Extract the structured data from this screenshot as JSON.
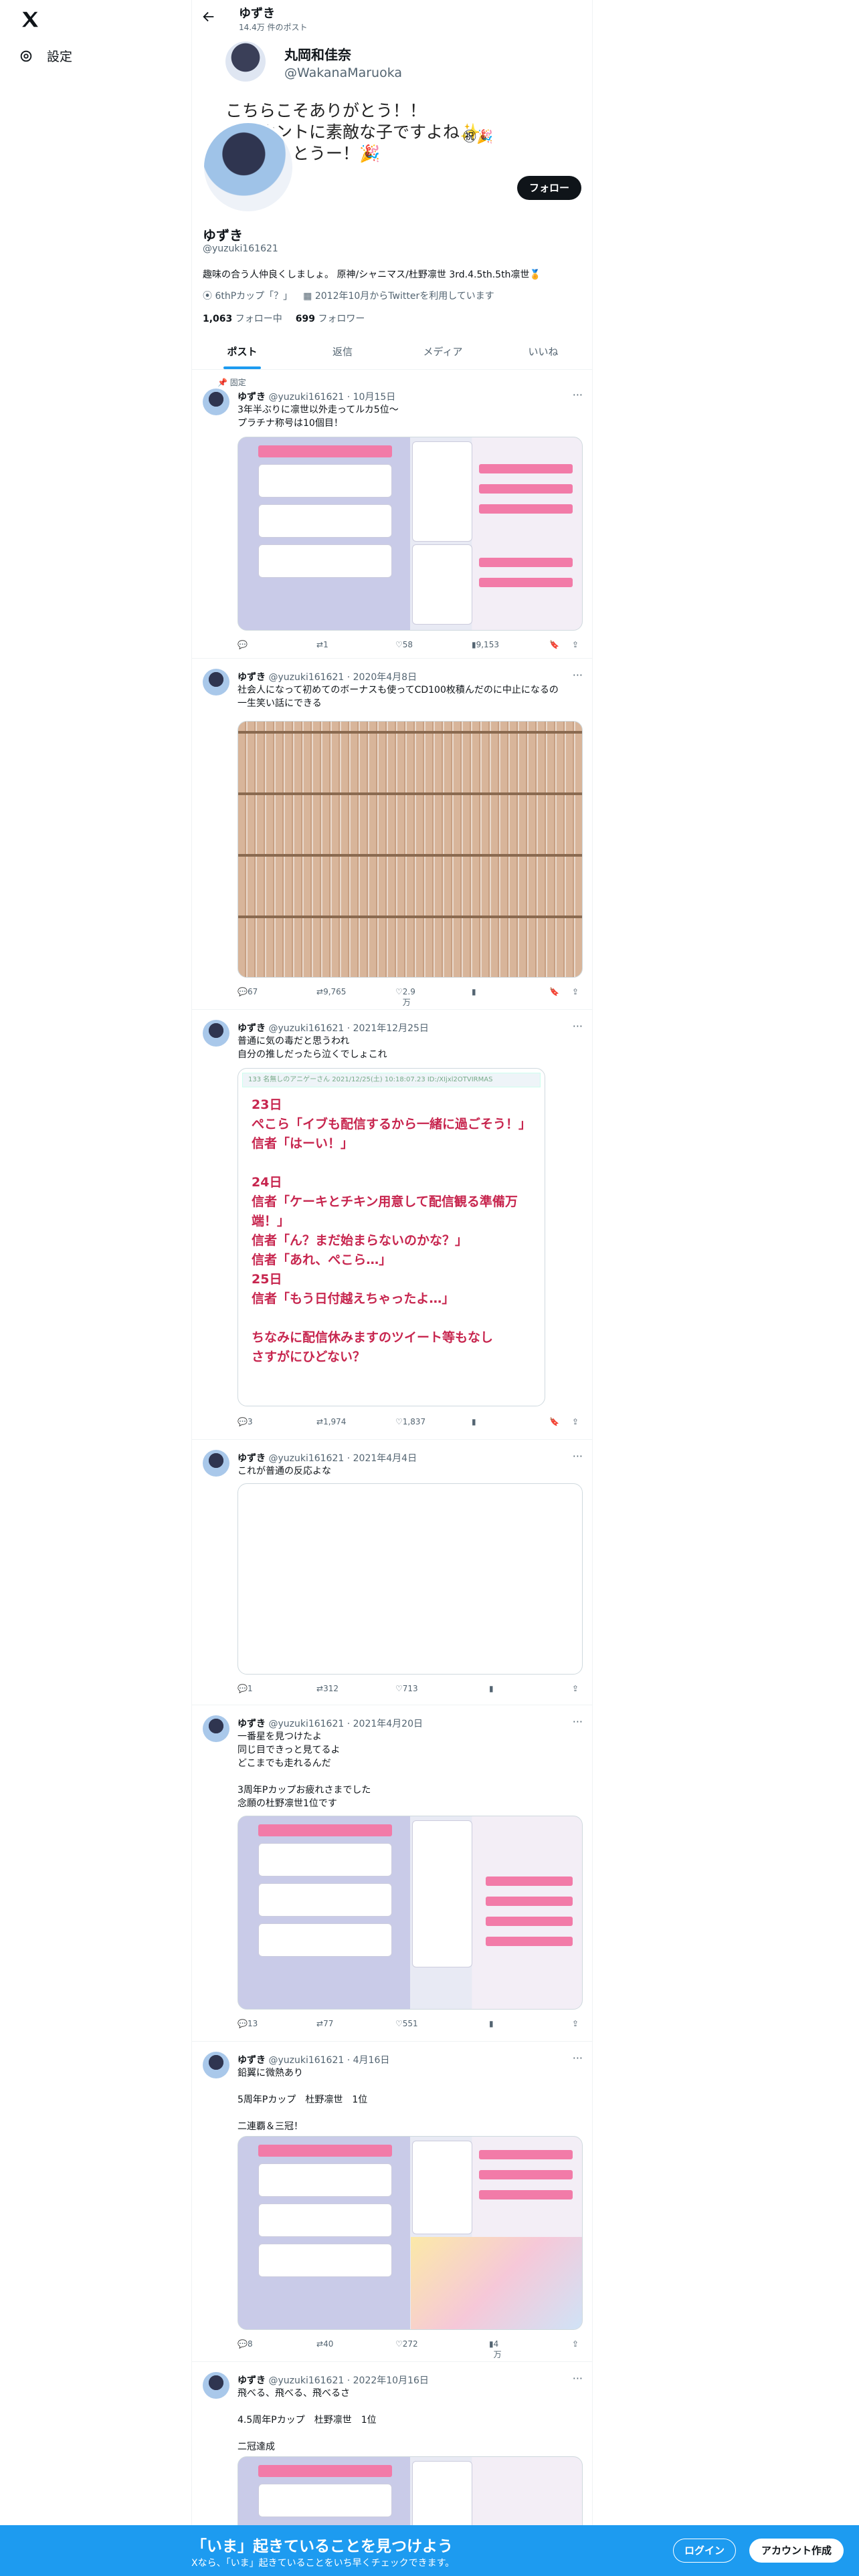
{
  "sidebar": {
    "settings": "設定"
  },
  "header": {
    "name": "ゆずき",
    "post_count": "14.4万 件のポスト"
  },
  "banner": {
    "name": "丸岡和佳奈",
    "handle": "@WakanaMaruoka",
    "text": "こちらこそありがとう！！\nゃんホントに素敵な子ですよね✨\n位おめでとうー！🎉",
    "emoji": "㊗🎉"
  },
  "profile": {
    "follow": "フォロー",
    "name": "ゆずき",
    "handle": "@yuzuki161621",
    "bio": "趣味の合う人仲良くしましょ。 原神/シャニマス/杜野凛世 3rd.4.5th.5th凛世🏅",
    "location": "6thPカップ「？」",
    "joined": "2012年10月からTwitterを利用しています",
    "following": "1,063",
    "following_label": "フォロー中",
    "followers": "699",
    "followers_label": "フォロワー"
  },
  "tabs": [
    "ポスト",
    "返信",
    "メディア",
    "いいね"
  ],
  "pinned_label": "固定",
  "tweets": [
    {
      "name": "ゆずき",
      "handle": "@yuzuki161621",
      "date": "10月15日",
      "text": "3年半ぶりに凛世以外走ってルカ5位〜\nプラチナ称号は10個目！",
      "reply": "",
      "rt": "1",
      "like": "58",
      "views": "9,153"
    },
    {
      "name": "ゆずき",
      "handle": "@yuzuki161621",
      "date": "2020年4月8日",
      "text": "社会人になって初めてのボーナスも使ってCD100枚積んだのに中止になるの\n一生笑い話にできる",
      "reply": "67",
      "rt": "9,765",
      "like": "2.9万",
      "views": ""
    },
    {
      "name": "ゆずき",
      "handle": "@yuzuki161621",
      "date": "2021年12月25日",
      "text": "普通に気の毒だと思うわれ\n自分の推しだったら泣くでしょこれ",
      "reply": "3",
      "rt": "1,974",
      "like": "1,837",
      "views": "",
      "quote_head": "133 名無しのアニゲーさん 2021/12/25(土) 10:18:07.23 ID:/XIjxl2OTVIRMAS",
      "quote": "23日\nぺこら「イブも配信するから一緒に過ごそう！」\n信者「はーい！」\n\n24日\n信者「ケーキとチキン用意して配信観る準備万端！」\n信者「ん？まだ始まらないのかな？」\n信者「あれ、ぺこら…」\n25日\n信者「もう日付越えちゃったよ…」\n\nちなみに配信休みますのツイート等もなし\nさすがにひどない？"
    },
    {
      "name": "ゆずき",
      "handle": "@yuzuki161621",
      "date": "2021年4月4日",
      "text": "これが普通の反応よな",
      "reply": "1",
      "rt": "312",
      "like": "713",
      "views": ""
    },
    {
      "name": "ゆずき",
      "handle": "@yuzuki161621",
      "date": "2021年4月20日",
      "text": "一番星を見つけたよ\n同じ目できっと見てるよ\nどこまでも走れるんだ\n\n3周年Pカップお疲れさまでした\n念願の杜野凛世1位です",
      "reply": "13",
      "rt": "77",
      "like": "551",
      "views": ""
    },
    {
      "name": "ゆずき",
      "handle": "@yuzuki161621",
      "date": "4月16日",
      "text": "鉛翼に微熱あり\n\n5周年Pカップ　杜野凛世　1位\n\n二連覇＆三冠！",
      "reply": "8",
      "rt": "40",
      "like": "272",
      "views": "4万"
    },
    {
      "name": "ゆずき",
      "handle": "@yuzuki161621",
      "date": "2022年10月16日",
      "text": "飛べる、飛べる、飛べるさ\n\n4.5周年Pカップ　杜野凛世　1位\n\n二冠達成",
      "reply": "",
      "rt": "",
      "like": "",
      "views": ""
    }
  ],
  "bottom": {
    "title": "「いま」起きていることを見つけよう",
    "sub": "Xなら、「いま」起きていることをいち早くチェックできます。",
    "login": "ログイン",
    "signup": "アカウント作成"
  },
  "colors": {
    "accent": "#1d9bf0",
    "quote_text": "#c7254e"
  }
}
